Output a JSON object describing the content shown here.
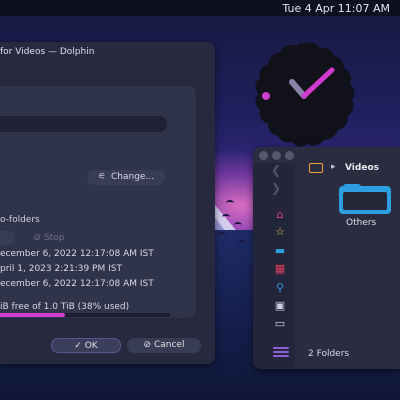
{
  "panel": {
    "clock": "Tue 4 Apr  11:07 AM"
  },
  "dolphin_settings": {
    "title": "for Videos — Dolphin",
    "change_label": "Change...",
    "change_icon": "sliders-icon",
    "subfolders_label": "o-folders",
    "stop_label": "Stop",
    "dates": [
      "ecember 6, 2022 12:17:08 AM IST",
      "pril 1, 2023 2:21:39 PM IST",
      "ecember 6, 2022 12:17:08 AM IST"
    ],
    "free_space": "iB free of 1.0 TiB (38% used)",
    "usage_fraction": 0.38,
    "ok_label": "OK",
    "cancel_label": "Cancel",
    "accent": "#d23bd0"
  },
  "file_manager": {
    "breadcrumb": "Videos",
    "items": [
      {
        "name": "Others",
        "icon": "folder-icon"
      }
    ],
    "sidebar_icons": [
      "home-icon",
      "star-icon",
      "folder-icon",
      "apps-icon",
      "search-icon",
      "window-icon",
      "terminal-icon"
    ],
    "status": "2 Folders",
    "accent": "#2d9fe0"
  }
}
